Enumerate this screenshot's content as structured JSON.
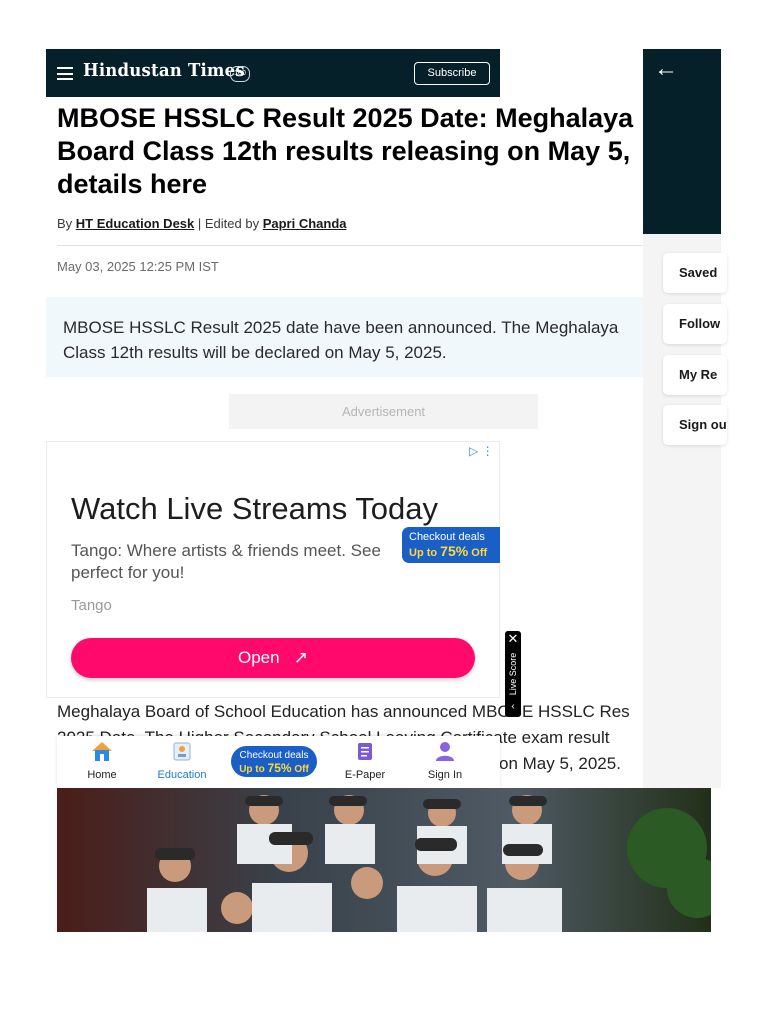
{
  "header": {
    "logo": "Hindustan Times",
    "logo_badge": "100",
    "subscribe_label": "Subscribe"
  },
  "article": {
    "headline": "MBOSE HSSLC Result 2025 Date: Meghalaya Board Class 12th results releasing on May 5, details here",
    "byline_prefix": "By",
    "author": "HT Education Desk",
    "edited_prefix": "| Edited by",
    "editor": "Papri Chanda",
    "date": "May 03, 2025 12:25 PM IST",
    "summary": "MBOSE HSSLC Result 2025 date have been announced. The Meghalaya Class 12th results will be declared on May 5, 2025.",
    "advertisement_label": "Advertisement",
    "body_line1": "Meghalaya Board of School Education has announced MBOSE HSSLC Res",
    "body_line2": "2025 Date. The Higher Secondary School Leaving Certificate exam result",
    "body_line3": "on May 5, 2025."
  },
  "ad": {
    "title": "Watch Live Streams Today",
    "description": "Tango: Where artists & friends meet. See perfect for you!",
    "brand": "Tango",
    "cta": "Open",
    "adchoices": "▷ ⋮"
  },
  "deals_tag": {
    "line1": "Checkout deals",
    "up_to": "Up to",
    "percent": "75%",
    "off": "Off"
  },
  "bottom_nav": {
    "items": [
      {
        "label": "Home",
        "icon": "home-icon"
      },
      {
        "label": "Education",
        "icon": "education-icon"
      },
      {
        "label": "E-Paper",
        "icon": "epaper-icon"
      },
      {
        "label": "Sign In",
        "icon": "user-icon"
      }
    ],
    "deals_line1": "Checkout deals",
    "deals_up_to": "Up to",
    "deals_percent": "75%",
    "deals_off": "Off"
  },
  "live_score": {
    "label": "Live Score"
  },
  "drawer": {
    "items": [
      {
        "label": "Saved"
      },
      {
        "label": "Follow"
      },
      {
        "label": "My Re"
      },
      {
        "label": "Sign ou"
      }
    ]
  },
  "colors": {
    "header_bg": "#06202a",
    "cta_pink": "#ff0a6c",
    "deals_blue": "#1a5fc6",
    "active_nav": "#1f7ad0"
  }
}
